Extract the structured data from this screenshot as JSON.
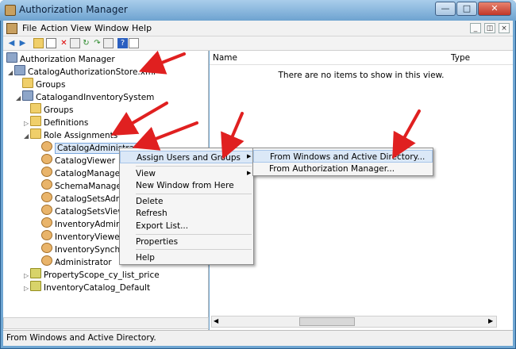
{
  "window": {
    "title": "Authorization Manager"
  },
  "menubar": {
    "items": [
      "File",
      "Action",
      "View",
      "Window",
      "Help"
    ]
  },
  "tree": {
    "root": "Authorization Manager",
    "store": "CatalogAuthorizationStore.xml",
    "store_groups": "Groups",
    "app": "CatalogandInventorySystem",
    "app_groups": "Groups",
    "definitions": "Definitions",
    "role_assignments": "Role Assignments",
    "roles": [
      "CatalogAdministrator",
      "CatalogViewer",
      "CatalogManager",
      "SchemaManager",
      "CatalogSetsAdmin",
      "CatalogSetsViewer",
      "InventoryAdminist",
      "InventoryViewer",
      "InventorySynchron",
      "Administrator"
    ],
    "scopes": [
      "PropertyScope_cy_list_price",
      "InventoryCatalog_Default"
    ]
  },
  "list": {
    "col_name": "Name",
    "col_type": "Type",
    "empty_text": "There are no items to show in this view."
  },
  "context_menu": {
    "items": [
      "Assign Users and Groups",
      "View",
      "New Window from Here",
      "Delete",
      "Refresh",
      "Export List...",
      "Properties",
      "Help"
    ]
  },
  "submenu": {
    "items": [
      "From Windows and Active Directory...",
      "From Authorization Manager..."
    ]
  },
  "status": {
    "text": "From Windows and Active Directory."
  },
  "colors": {
    "titlebar": "#6ea3d0",
    "selection": "#dbe8f7",
    "annotation_arrow": "#e02020"
  }
}
